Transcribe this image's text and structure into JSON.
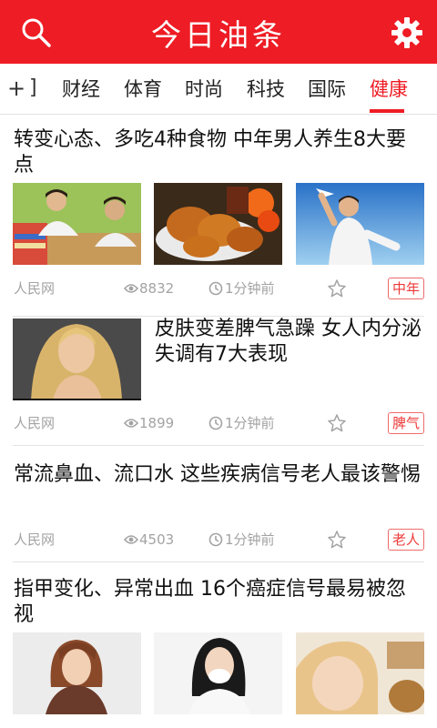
{
  "header": {
    "title": "今日油条",
    "search_icon": "search-icon",
    "settings_icon": "gear-icon",
    "brand_color": "#ee1c24"
  },
  "tabs": {
    "add_label": "+",
    "partial_label": "]",
    "items": [
      {
        "label": "财经"
      },
      {
        "label": "体育"
      },
      {
        "label": "时尚"
      },
      {
        "label": "科技"
      },
      {
        "label": "国际"
      },
      {
        "label": "健康"
      }
    ],
    "active_index": 5
  },
  "articles": [
    {
      "headline": "转变心态、多吃4种食物 中年男人养生8大要点",
      "source": "人民网",
      "views": "8832",
      "time": "1分钟前",
      "tag": "中年"
    },
    {
      "headline": "皮肤变差脾气急躁 女人内分泌失调有7大表现",
      "source": "人民网",
      "views": "1899",
      "time": "1分钟前",
      "tag": "脾气"
    },
    {
      "headline": "常流鼻血、流口水 这些疾病信号老人最该警惕",
      "source": "人民网",
      "views": "4503",
      "time": "1分钟前",
      "tag": "老人"
    },
    {
      "headline": "指甲变化、异常出血 16个癌症信号最易被忽视"
    }
  ]
}
